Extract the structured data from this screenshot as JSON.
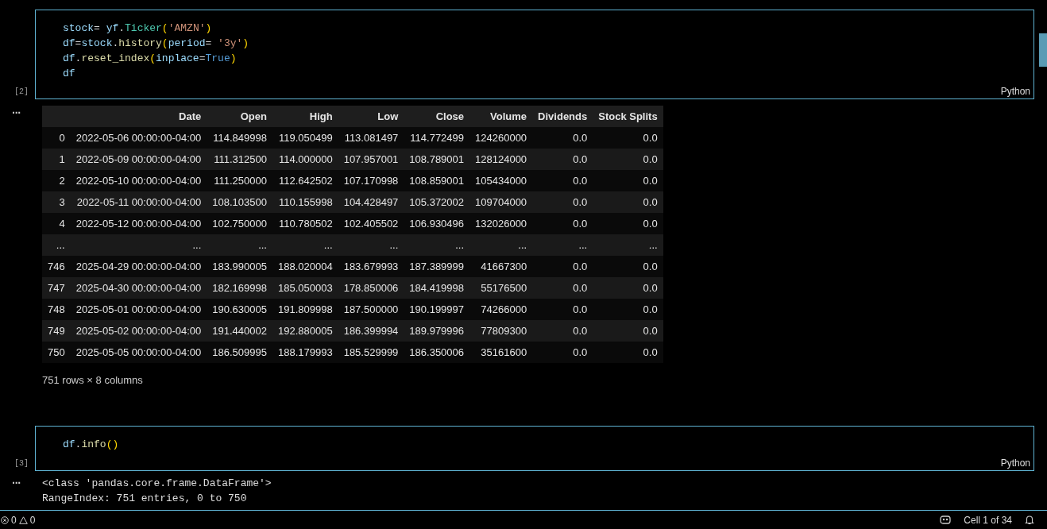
{
  "cells": [
    {
      "execution_count": "[2]",
      "language": "Python",
      "code": [
        [
          {
            "text": "stock",
            "kind": "var"
          },
          {
            "text": "= ",
            "kind": "op"
          },
          {
            "text": "yf",
            "kind": "var"
          },
          {
            "text": ".",
            "kind": "op"
          },
          {
            "text": "Ticker",
            "kind": "class"
          },
          {
            "text": "(",
            "kind": "paren"
          },
          {
            "text": "'AMZN'",
            "kind": "string"
          },
          {
            "text": ")",
            "kind": "paren"
          }
        ],
        [
          {
            "text": "df",
            "kind": "var"
          },
          {
            "text": "=",
            "kind": "op"
          },
          {
            "text": "stock",
            "kind": "var"
          },
          {
            "text": ".",
            "kind": "op"
          },
          {
            "text": "history",
            "kind": "func"
          },
          {
            "text": "(",
            "kind": "paren"
          },
          {
            "text": "period",
            "kind": "var"
          },
          {
            "text": "= ",
            "kind": "op"
          },
          {
            "text": "'3y'",
            "kind": "string"
          },
          {
            "text": ")",
            "kind": "paren"
          }
        ],
        [
          {
            "text": "df",
            "kind": "var"
          },
          {
            "text": ".",
            "kind": "op"
          },
          {
            "text": "reset_index",
            "kind": "func"
          },
          {
            "text": "(",
            "kind": "paren"
          },
          {
            "text": "inplace",
            "kind": "var"
          },
          {
            "text": "=",
            "kind": "op"
          },
          {
            "text": "True",
            "kind": "const"
          },
          {
            "text": ")",
            "kind": "paren"
          }
        ],
        [
          {
            "text": "df",
            "kind": "var"
          }
        ]
      ],
      "output": {
        "prompt": "···",
        "kind": "table",
        "columns": [
          "Date",
          "Open",
          "High",
          "Low",
          "Close",
          "Volume",
          "Dividends",
          "Stock Splits"
        ],
        "rows": [
          {
            "index": "0",
            "cells": [
              "2022-05-06 00:00:00-04:00",
              "114.849998",
              "119.050499",
              "113.081497",
              "114.772499",
              "124260000",
              "0.0",
              "0.0"
            ]
          },
          {
            "index": "1",
            "cells": [
              "2022-05-09 00:00:00-04:00",
              "111.312500",
              "114.000000",
              "107.957001",
              "108.789001",
              "128124000",
              "0.0",
              "0.0"
            ]
          },
          {
            "index": "2",
            "cells": [
              "2022-05-10 00:00:00-04:00",
              "111.250000",
              "112.642502",
              "107.170998",
              "108.859001",
              "105434000",
              "0.0",
              "0.0"
            ]
          },
          {
            "index": "3",
            "cells": [
              "2022-05-11 00:00:00-04:00",
              "108.103500",
              "110.155998",
              "104.428497",
              "105.372002",
              "109704000",
              "0.0",
              "0.0"
            ]
          },
          {
            "index": "4",
            "cells": [
              "2022-05-12 00:00:00-04:00",
              "102.750000",
              "110.780502",
              "102.405502",
              "106.930496",
              "132026000",
              "0.0",
              "0.0"
            ]
          },
          {
            "index": "...",
            "cells": [
              "...",
              "...",
              "...",
              "...",
              "...",
              "...",
              "...",
              "..."
            ]
          },
          {
            "index": "746",
            "cells": [
              "2025-04-29 00:00:00-04:00",
              "183.990005",
              "188.020004",
              "183.679993",
              "187.389999",
              "41667300",
              "0.0",
              "0.0"
            ]
          },
          {
            "index": "747",
            "cells": [
              "2025-04-30 00:00:00-04:00",
              "182.169998",
              "185.050003",
              "178.850006",
              "184.419998",
              "55176500",
              "0.0",
              "0.0"
            ]
          },
          {
            "index": "748",
            "cells": [
              "2025-05-01 00:00:00-04:00",
              "190.630005",
              "191.809998",
              "187.500000",
              "190.199997",
              "74266000",
              "0.0",
              "0.0"
            ]
          },
          {
            "index": "749",
            "cells": [
              "2025-05-02 00:00:00-04:00",
              "191.440002",
              "192.880005",
              "186.399994",
              "189.979996",
              "77809300",
              "0.0",
              "0.0"
            ]
          },
          {
            "index": "750",
            "cells": [
              "2025-05-05 00:00:00-04:00",
              "186.509995",
              "188.179993",
              "185.529999",
              "186.350006",
              "35161600",
              "0.0",
              "0.0"
            ]
          }
        ],
        "shape": "751 rows × 8 columns"
      }
    },
    {
      "execution_count": "[3]",
      "language": "Python",
      "code": [
        [
          {
            "text": "df",
            "kind": "var"
          },
          {
            "text": ".",
            "kind": "op"
          },
          {
            "text": "info",
            "kind": "func"
          },
          {
            "text": "()",
            "kind": "paren"
          }
        ]
      ],
      "output": {
        "prompt": "···",
        "kind": "text",
        "lines": [
          "<class 'pandas.core.frame.DataFrame'>",
          "RangeIndex: 751 entries, 0 to 750"
        ]
      }
    }
  ],
  "status_bar": {
    "errors": "0",
    "warnings": "0",
    "cell_position": "Cell 1 of 34"
  }
}
